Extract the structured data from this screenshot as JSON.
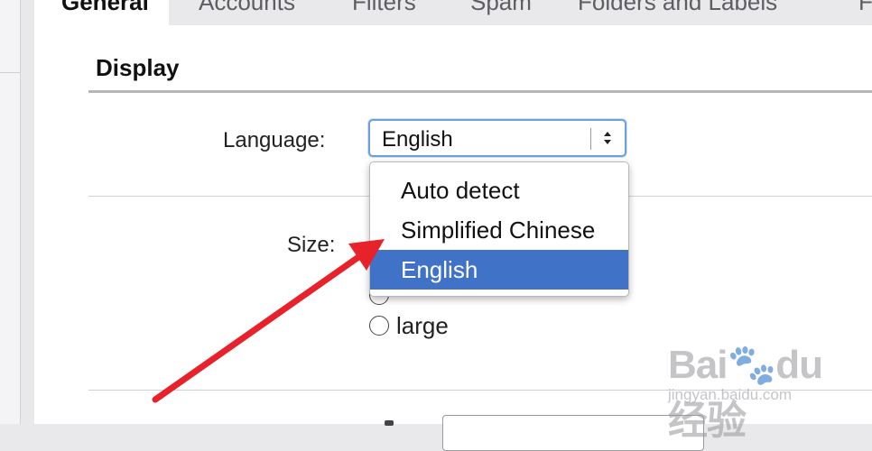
{
  "tabs": [
    {
      "label": "General"
    },
    {
      "label": "Accounts"
    },
    {
      "label": "Filters"
    },
    {
      "label": "Spam"
    },
    {
      "label": "Folders and Labels"
    },
    {
      "label": "F"
    }
  ],
  "section": {
    "title": "Display"
  },
  "language": {
    "label": "Language:",
    "selected": "English",
    "options": [
      "Auto detect",
      "Simplified Chinese",
      "English"
    ]
  },
  "size": {
    "label": "Size:",
    "option_large": "large"
  },
  "watermark": {
    "logo": "Bai🐾du 经验",
    "url": "jingyan.baidu.com"
  },
  "colors": {
    "accent": "#4073c8",
    "annotation_arrow": "#e8222a"
  }
}
